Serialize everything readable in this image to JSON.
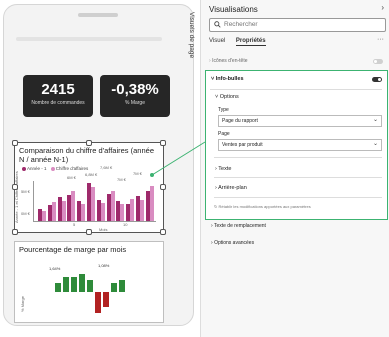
{
  "kpis": [
    {
      "value": "2415",
      "label": "Nombre de commandes"
    },
    {
      "value": "-0,38%",
      "label": "% Marge"
    }
  ],
  "chart1": {
    "title": "Comparaison du chiffre d'affaires (année N / année N-1)",
    "legend": [
      {
        "name": "Année - 1",
        "color": "#9e2a6b"
      },
      {
        "name": "Chiffre d'affaires",
        "color": "#d98cc1"
      }
    ],
    "y_ticks": [
      "5M €",
      "0M €"
    ],
    "y_label": "Année - 1 et Chiffre d'affaires",
    "x_ticks": [
      "5",
      "10"
    ],
    "x_label": "Mois",
    "labels": [
      "7,6M €",
      "6,8M €",
      "6M €",
      "7M €",
      "7M €"
    ]
  },
  "chart_data": {
    "type": "bar",
    "categories": [
      "1",
      "2",
      "3",
      "4",
      "5",
      "6",
      "7",
      "8",
      "9",
      "10",
      "11",
      "12"
    ],
    "series": [
      {
        "name": "Année - 1",
        "values": [
          2.5,
          3.2,
          4.8,
          5.2,
          4.0,
          7.6,
          4.2,
          5.5,
          4.0,
          3.5,
          5.0,
          6.0
        ]
      },
      {
        "name": "Chiffre d'affaires",
        "values": [
          2.0,
          3.8,
          4.0,
          6.0,
          3.4,
          6.8,
          3.6,
          6.0,
          3.4,
          4.5,
          4.2,
          7.0
        ]
      }
    ],
    "xlabel": "Mois",
    "ylabel": "Année - 1 et Chiffre d'affaires",
    "ylim": [
      0,
      8
    ]
  },
  "chart2": {
    "title": "Pourcentage de marge par mois",
    "y_label": "% Marge",
    "values": [
      3,
      5,
      5,
      6,
      4,
      -7,
      -5,
      3,
      4
    ],
    "labels": [
      "1,64%",
      "1,08%"
    ]
  },
  "panel": {
    "title": "Visualisations",
    "side_tab": "Visuels de page",
    "search_placeholder": "Rechercher",
    "tabs": [
      "Visuel",
      "Propriétés"
    ],
    "icons_row_label": "Icônes d'en-tête",
    "tooltips_label": "Info-bulles",
    "options_label": "Options",
    "type_label": "Type",
    "type_value": "Page du rapport",
    "page_label": "Page",
    "page_value": "Ventes par produit",
    "texte_label": "Texte",
    "background_label": "Arrière-plan",
    "reset_label": "Rétablir les modifications apportées aux paramètres",
    "alt_text_label": "Texte de remplacement",
    "advanced_label": "Options avancées",
    "colors": {
      "accent": "#3cb371",
      "toggle_on": "#333333"
    }
  }
}
